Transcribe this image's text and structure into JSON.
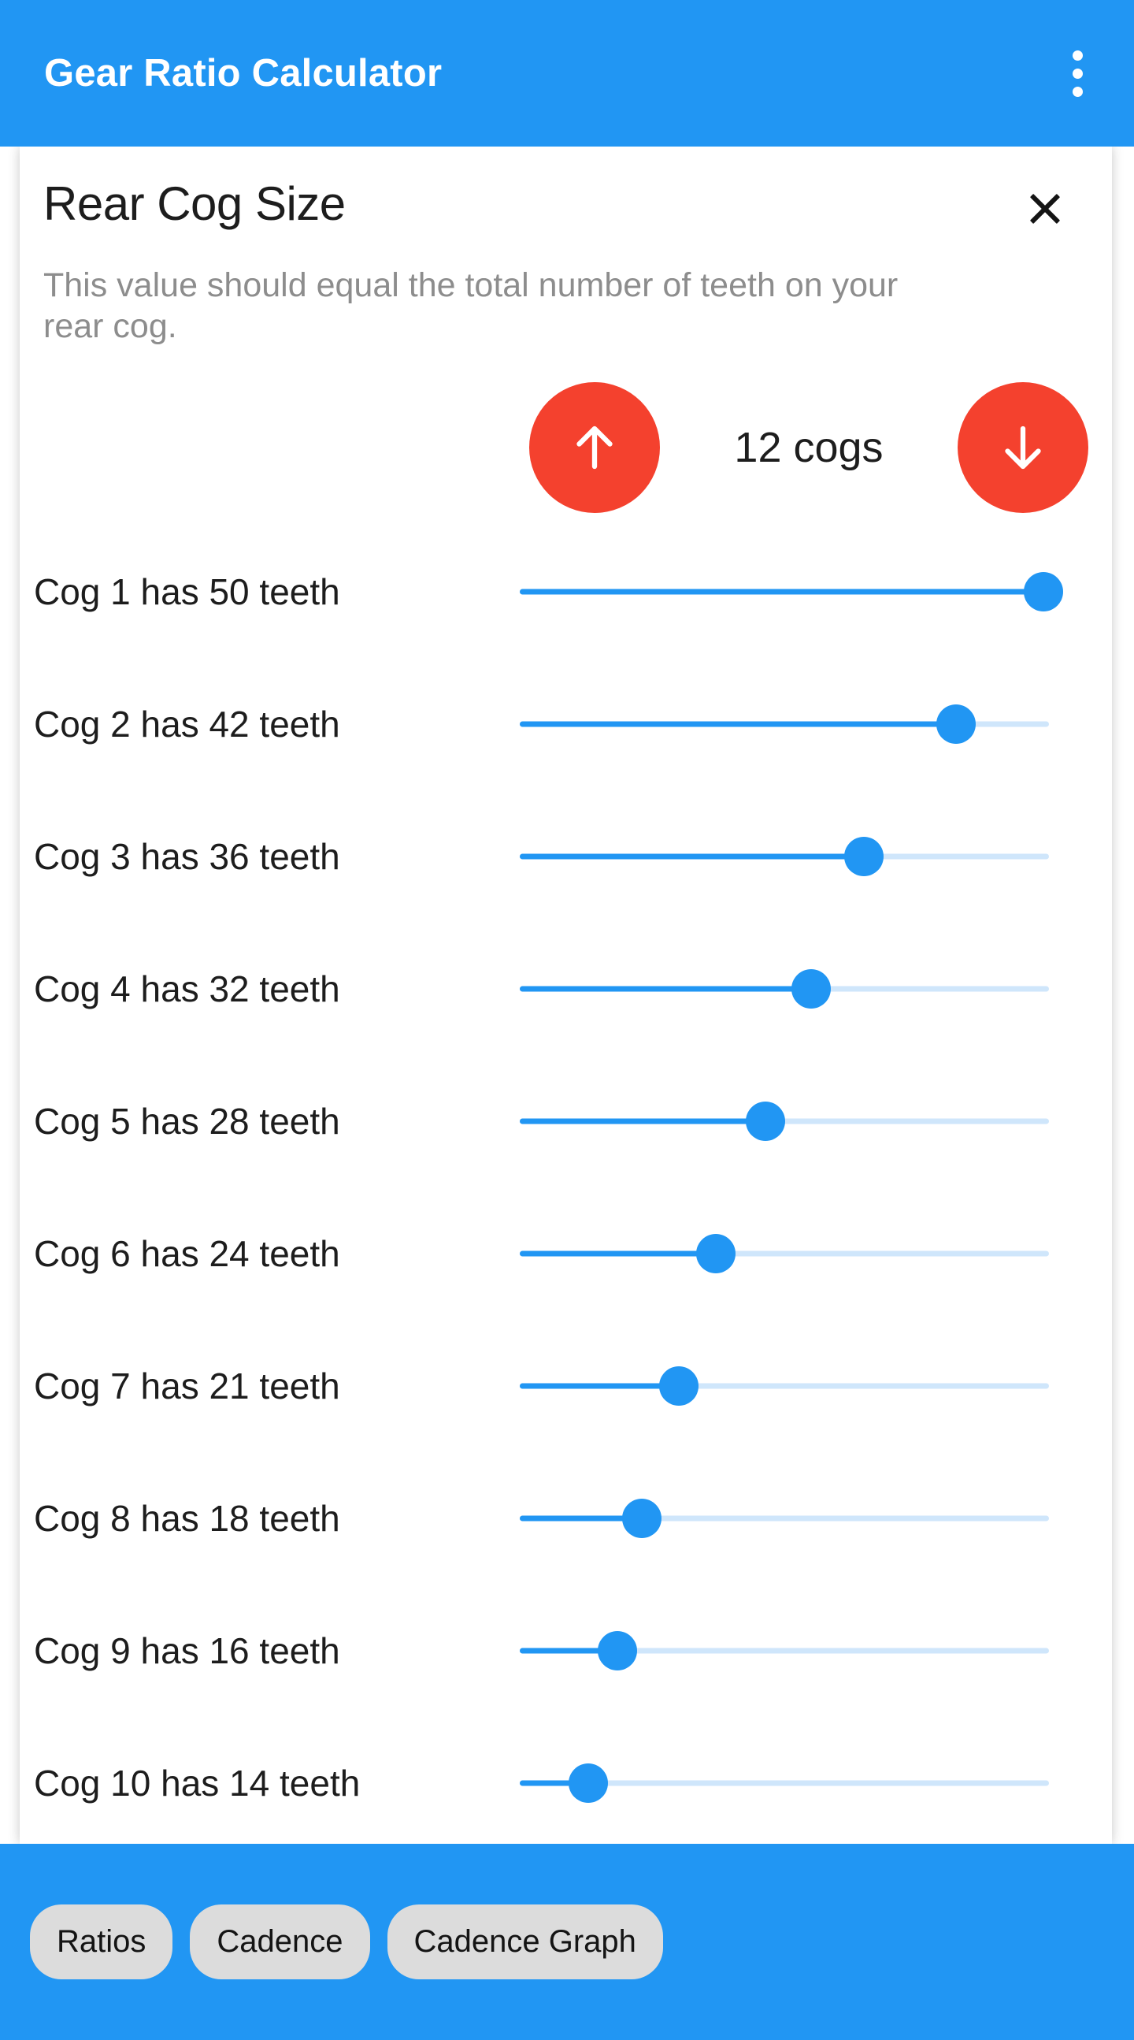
{
  "app": {
    "title": "Gear Ratio Calculator",
    "accent_blue": "#2196f3",
    "accent_red": "#f4412e",
    "overflow_icon": "more-vert-icon"
  },
  "dialog": {
    "title": "Rear Cog Size",
    "subtitle": "This value should equal the total number of teeth on your rear cog.",
    "close_icon": "close-icon",
    "stepper": {
      "increment_icon": "arrow-up-icon",
      "decrement_icon": "arrow-down-icon",
      "value_label": "12 cogs",
      "count": 12
    },
    "cogs": [
      {
        "label": "Cog 1 has 50 teeth",
        "teeth": 50,
        "fill_percent": 99.0
      },
      {
        "label": "Cog 2 has 42 teeth",
        "teeth": 42,
        "fill_percent": 82.5
      },
      {
        "label": "Cog 3 has 36 teeth",
        "teeth": 36,
        "fill_percent": 65.0
      },
      {
        "label": "Cog 4 has 32 teeth",
        "teeth": 32,
        "fill_percent": 55.0
      },
      {
        "label": "Cog 5 has 28 teeth",
        "teeth": 28,
        "fill_percent": 46.5
      },
      {
        "label": "Cog 6 has 24 teeth",
        "teeth": 24,
        "fill_percent": 37.0
      },
      {
        "label": "Cog 7 has 21 teeth",
        "teeth": 21,
        "fill_percent": 30.0
      },
      {
        "label": "Cog 8 has 18 teeth",
        "teeth": 18,
        "fill_percent": 23.0
      },
      {
        "label": "Cog 9 has 16 teeth",
        "teeth": 16,
        "fill_percent": 18.5
      },
      {
        "label": "Cog 10 has 14 teeth",
        "teeth": 14,
        "fill_percent": 13.0
      }
    ]
  },
  "bottom_tabs": [
    {
      "label": "Ratios"
    },
    {
      "label": "Cadence"
    },
    {
      "label": "Cadence Graph"
    }
  ]
}
